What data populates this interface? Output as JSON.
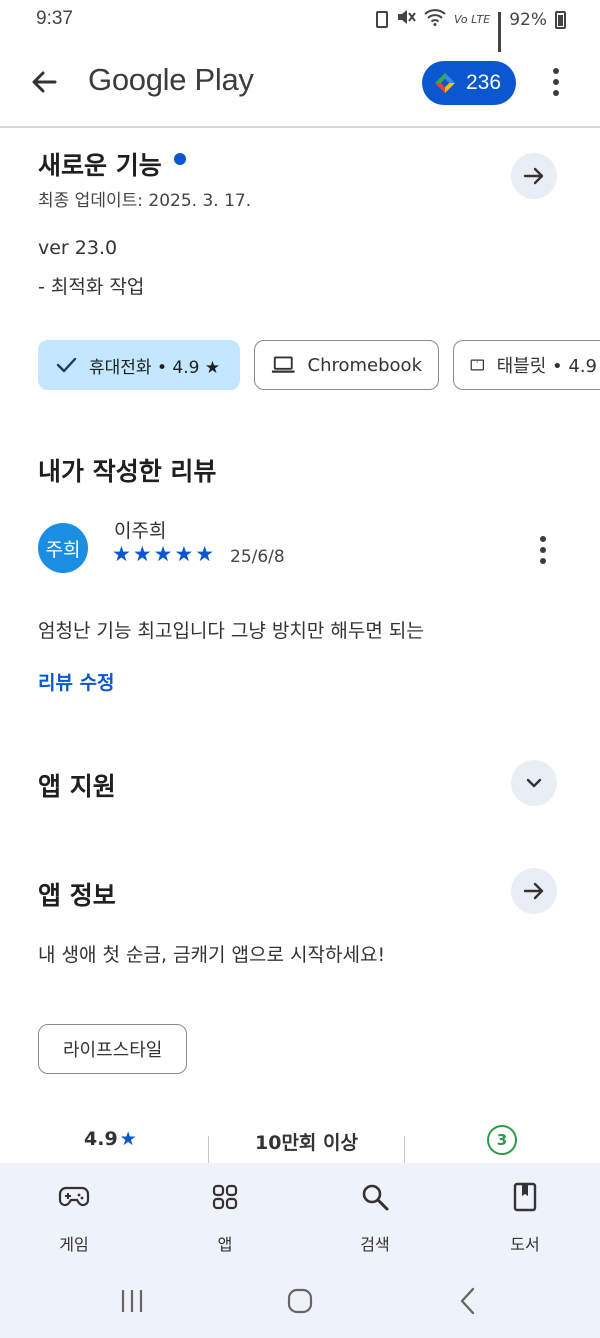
{
  "status_bar": {
    "time": "9:37",
    "battery": "92%",
    "network": "Vo LTE"
  },
  "app_bar": {
    "title": "Google Play",
    "points": "236"
  },
  "whats_new": {
    "title": "새로운 기능",
    "updated": "최종 업데이트: 2025. 3. 17.",
    "version": "ver 23.0",
    "note": "- 최적화 작업"
  },
  "devices": [
    {
      "label": "휴대전화 • 4.9 ★",
      "icon": "check-icon",
      "selected": true
    },
    {
      "label": "Chromebook",
      "icon": "laptop-icon",
      "selected": false
    },
    {
      "label": "태블릿 • 4.9",
      "icon": "tablet-icon",
      "selected": false
    }
  ],
  "my_review": {
    "title": "내가 작성한 리뷰",
    "avatar_text": "주희",
    "name": "이주희",
    "rating": 5,
    "stars": "★★★★★",
    "date": "25/6/8",
    "body": "엄청난 기능 최고입니다 그냥 방치만 해두면 되는",
    "edit_label": "리뷰 수정"
  },
  "app_support": {
    "title": "앱 지원"
  },
  "about": {
    "title": "앱 정보",
    "description": "내 생애 첫 순금, 금캐기 앱으로 시작하세요!",
    "category": "라이프스타일"
  },
  "stats": {
    "rating": "4.9",
    "rating_star": "★",
    "downloads": "10만회 이상",
    "age_rating": "3"
  },
  "bottom_nav": [
    {
      "label": "게임",
      "icon": "gamepad-icon"
    },
    {
      "label": "앱",
      "icon": "apps-grid-icon"
    },
    {
      "label": "검색",
      "icon": "search-icon"
    },
    {
      "label": "도서",
      "icon": "book-icon"
    }
  ],
  "colors": {
    "accent": "#0b57d0",
    "chip_selected": "#c2e7ff",
    "nav_background": "#eef2f9",
    "avatar": "#1a8ee0",
    "age_badge": "#2e9a48"
  }
}
